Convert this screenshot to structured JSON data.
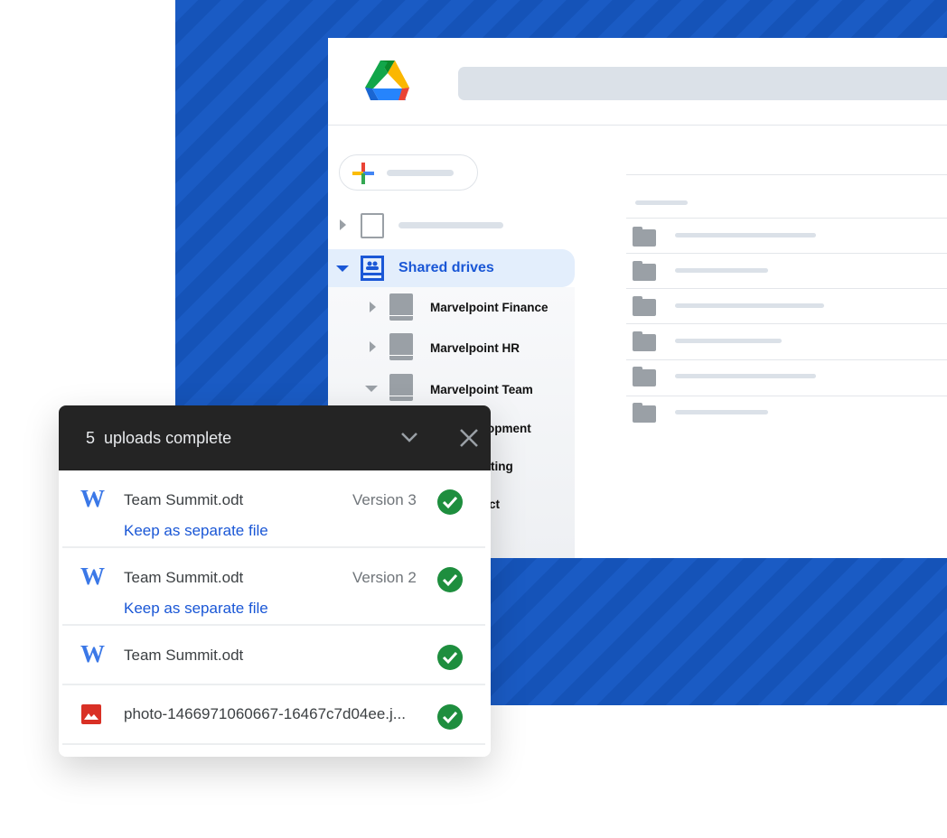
{
  "sidebar": {
    "shared_drives_label": "Shared drives",
    "drives": [
      {
        "label": "Marvelpoint Finance",
        "expanded": false
      },
      {
        "label": "Marvelpoint HR",
        "expanded": false
      },
      {
        "label": "Marvelpoint Team",
        "expanded": true
      }
    ],
    "sub_items": [
      "Development",
      "Marketing",
      "Product"
    ]
  },
  "upload_panel": {
    "title": "5  uploads complete",
    "items": [
      {
        "name": "Team Summit.odt",
        "type": "document",
        "version": "Version 3",
        "action": "Keep as separate file",
        "status": "complete"
      },
      {
        "name": "Team Summit.odt",
        "type": "document",
        "version": "Version 2",
        "action": "Keep as separate file",
        "status": "complete"
      },
      {
        "name": "Team Summit.odt",
        "type": "document",
        "status": "complete"
      },
      {
        "name": "photo-1466971060667-16467c7d04ee.j...",
        "type": "image",
        "status": "complete"
      }
    ],
    "doc_icon_glyph": "W"
  },
  "colors": {
    "accent": "#1a57d6",
    "background": "#1a5bc4",
    "success": "#1e8e3e",
    "header": "#242424"
  }
}
